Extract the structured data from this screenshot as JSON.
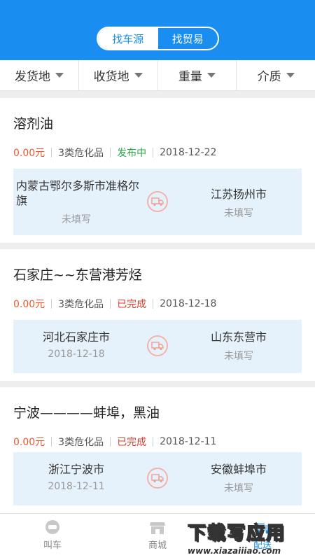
{
  "header": {
    "tabs": [
      {
        "label": "找车源",
        "active": true
      },
      {
        "label": "找贸易",
        "active": false
      }
    ]
  },
  "filters": [
    "发货地",
    "收货地",
    "重量",
    "介质"
  ],
  "cards": [
    {
      "title": "溶剂油",
      "price": "0.00元",
      "category": "3类危化品",
      "status": "发布中",
      "date": "2018-12-22",
      "from": {
        "name": "内蒙古鄂尔多斯市准格尔旗",
        "sub": "未填写"
      },
      "to": {
        "name": "江苏扬州市",
        "sub": "未填写"
      }
    },
    {
      "title": "石家庄~~东营港芳烃",
      "price": "0.00元",
      "category": "3类危化品",
      "status": "已完成",
      "date": "2018-12-18",
      "from": {
        "name": "河北石家庄市",
        "sub": "2018-12-18"
      },
      "to": {
        "name": "山东东营市",
        "sub": "未填写"
      }
    },
    {
      "title": "宁波————蚌埠，黑油",
      "price": "0.00元",
      "category": "3类危化品",
      "status": "已完成",
      "date": "2018-12-11",
      "from": {
        "name": "浙江宁波市",
        "sub": "2018-12-11"
      },
      "to": {
        "name": "安徽蚌埠市",
        "sub": "未填写"
      }
    }
  ],
  "tabbar": [
    {
      "label": "叫车",
      "icon": "taxi-icon"
    },
    {
      "label": "商城",
      "icon": "store-icon"
    },
    {
      "label": "配送",
      "icon": "delivery-icon"
    }
  ],
  "watermark": {
    "big": "下载写应用",
    "small": "www.xiazaiiiao.com"
  },
  "colors": {
    "primary": "#1a8ef0",
    "price": "#e85a2c",
    "published": "#29a84a",
    "completed": "#e03a2a"
  }
}
